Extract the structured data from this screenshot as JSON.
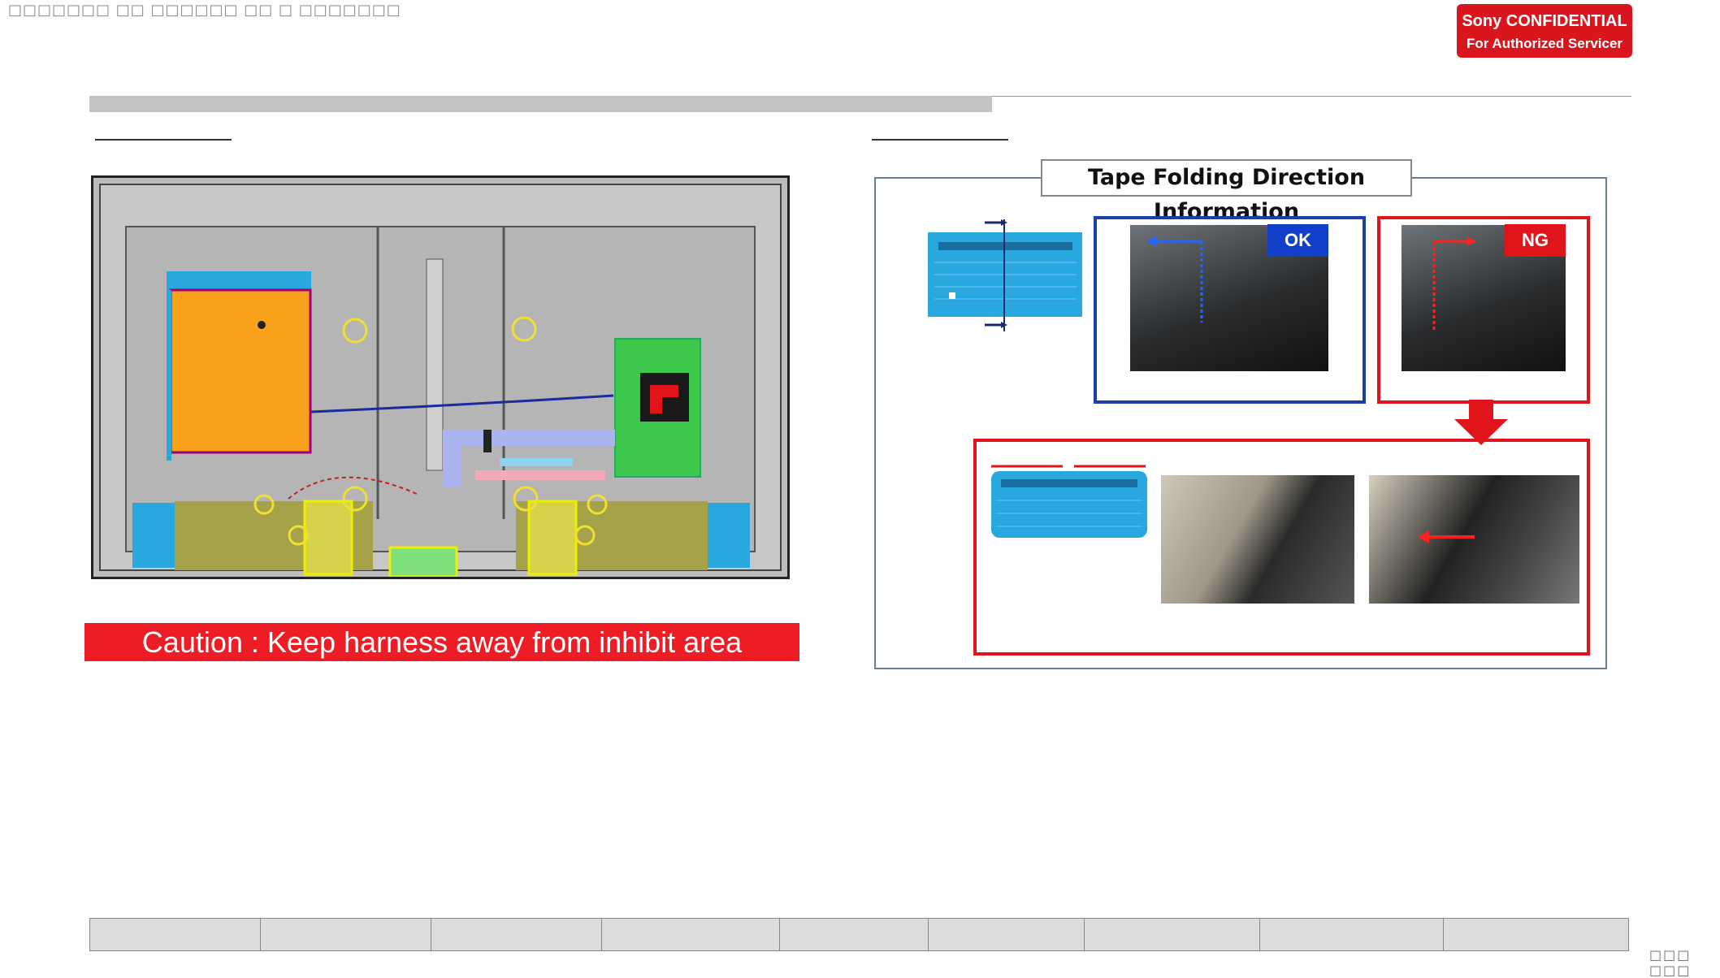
{
  "header": {
    "title": "□□□□□□□ □□ □□□□□□ □□ □ □□□□□□□"
  },
  "badge": {
    "line1": "Sony CONFIDENTIAL",
    "line2": "For Authorized Servicer"
  },
  "left": {
    "caution": "Caution : Keep harness away from inhibit area"
  },
  "right": {
    "title": "Tape Folding Direction Information",
    "ok_label": "OK",
    "ng_label": "NG"
  },
  "colors": {
    "sony_red": "#d9161d",
    "ok_blue": "#1b3fa6",
    "ng_red": "#e0141b",
    "part_blue": "#29a8e0",
    "board_orange": "#f9a11b",
    "board_green": "#3cc84a"
  },
  "footer": {
    "cells": 9,
    "page": "□□□ □□□"
  }
}
